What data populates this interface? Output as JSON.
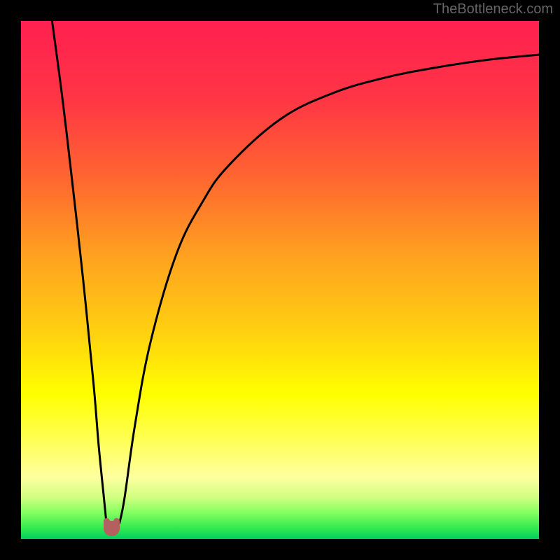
{
  "watermark": "TheBottleneck.com",
  "chart_data": {
    "type": "line",
    "title": "",
    "xlabel": "",
    "ylabel": "",
    "x_range": [
      0,
      100
    ],
    "y_range": [
      0,
      100
    ],
    "series": [
      {
        "name": "bottleneck-curve-left",
        "x": [
          6,
          8,
          10,
          12,
          14,
          15,
          16,
          16.5
        ],
        "y": [
          100,
          85,
          68,
          50,
          30,
          18,
          8,
          3
        ]
      },
      {
        "name": "bottleneck-curve-right",
        "x": [
          19,
          20,
          22,
          25,
          30,
          35,
          40,
          50,
          60,
          70,
          80,
          90,
          100
        ],
        "y": [
          3,
          8,
          22,
          38,
          55,
          65,
          72,
          81,
          86,
          89,
          91,
          92.5,
          93.5
        ]
      }
    ],
    "optimal_marker": {
      "x": 17.5,
      "y": 2,
      "width": 3,
      "height": 3
    },
    "gradient_stops": [
      {
        "offset": 0,
        "color": "#ff2050"
      },
      {
        "offset": 15,
        "color": "#ff3545"
      },
      {
        "offset": 30,
        "color": "#ff6530"
      },
      {
        "offset": 45,
        "color": "#ffa020"
      },
      {
        "offset": 60,
        "color": "#ffd010"
      },
      {
        "offset": 72,
        "color": "#ffff00"
      },
      {
        "offset": 82,
        "color": "#ffff60"
      },
      {
        "offset": 88,
        "color": "#ffffa0"
      },
      {
        "offset": 92,
        "color": "#d0ff80"
      },
      {
        "offset": 95,
        "color": "#80ff60"
      },
      {
        "offset": 98,
        "color": "#30e850"
      },
      {
        "offset": 100,
        "color": "#00d060"
      }
    ]
  }
}
